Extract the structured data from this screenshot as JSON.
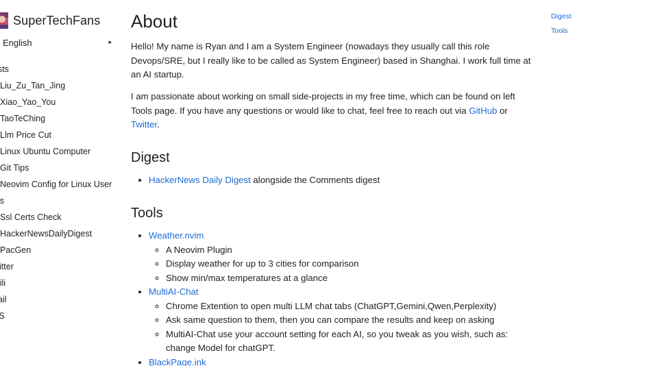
{
  "site": {
    "name": "SuperTechFans",
    "language": "English"
  },
  "sidebar": {
    "sections": [
      {
        "title": "osts",
        "items": [
          "Liu_Zu_Tan_Jing",
          "Xiao_Yao_You",
          "TaoTeChing",
          "Llm Price Cut",
          "Linux Ubuntu Computer",
          "Git Tips",
          "Neovim Config for Linux User"
        ]
      },
      {
        "title": "ols",
        "items": [
          "Ssl Certs Check",
          "HackerNewsDailyDigest",
          "PacGen"
        ]
      }
    ],
    "links": [
      "witter",
      "ibili",
      "nail",
      "SS"
    ]
  },
  "page": {
    "title": "About",
    "intro_p1": "Hello! My name is Ryan and I am a System Engineer (nowadays they usually call this role Devops/SRE, but I really like to be called as System Engineer) based in Shanghai. I work full time at an AI startup.",
    "intro_p2_prefix": "I am passionate about working on small side-projects in my free time, which can be found on left Tools page. If you have any questions or would like to chat, feel free to reach out via ",
    "github_label": "GitHub",
    "intro_p2_mid": " or ",
    "twitter_label": "Twitter",
    "intro_p2_suffix": ".",
    "digest_heading": "Digest",
    "digest_link": "HackerNews Daily Digest",
    "digest_rest": " alongside the Comments digest",
    "tools_heading": "Tools",
    "tools": [
      {
        "name": "Weather.nvim",
        "details": [
          "A Neovim Plugin",
          "Display weather for up to 3 cities for comparison",
          "Show min/max temperatures at a glance"
        ]
      },
      {
        "name": "MultiAI-Chat",
        "details": [
          "Chrome Extention to open multi LLM chat tabs (ChatGPT,Gemini,Qwen,Perplexity)",
          "Ask same question to them, then you can compare the results and keep on asking",
          "MultiAI-Chat use your account setting for each AI, so you tweak as you wish, such as: change Model for chatGPT."
        ]
      },
      {
        "name": "BlackPage.ink",
        "details": []
      }
    ]
  },
  "toc": {
    "items": [
      "Digest",
      "Tools"
    ]
  },
  "colors": {
    "link": "#1d6bd6",
    "text": "#222222",
    "background": "#ffffff"
  }
}
